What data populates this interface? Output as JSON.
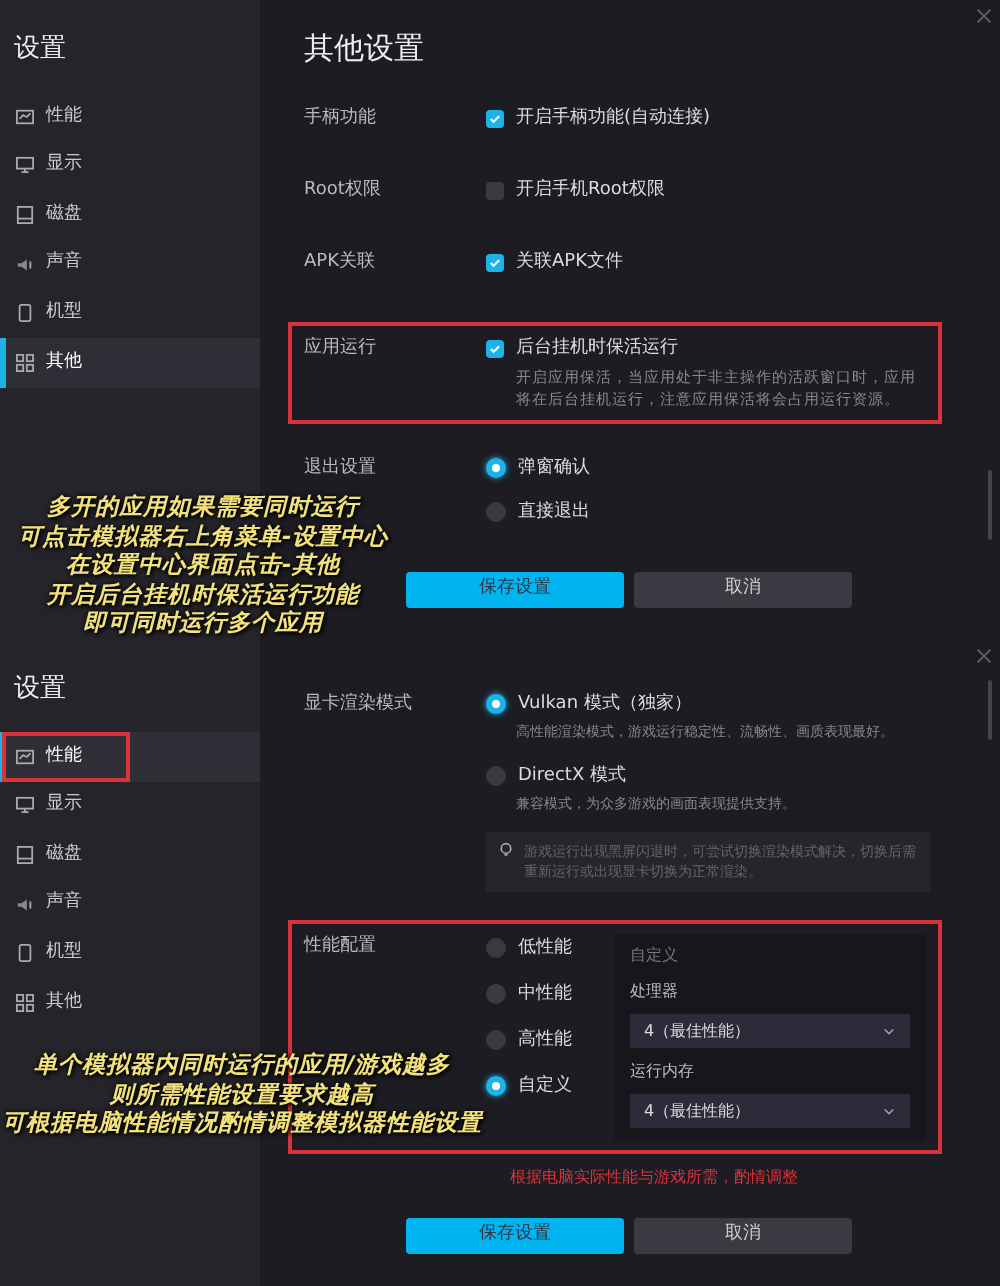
{
  "panels": [
    {
      "sidebar": {
        "title": "设置",
        "items": [
          {
            "label": "性能",
            "selected": false,
            "highlighted": false
          },
          {
            "label": "显示",
            "selected": false,
            "highlighted": false
          },
          {
            "label": "磁盘",
            "selected": false,
            "highlighted": false
          },
          {
            "label": "声音",
            "selected": false,
            "highlighted": false
          },
          {
            "label": "机型",
            "selected": false,
            "highlighted": false
          },
          {
            "label": "其他",
            "selected": true,
            "highlighted": false
          }
        ]
      },
      "content": {
        "title": "其他设置",
        "rows": [
          {
            "kind": "checkbox",
            "label": "手柄功能",
            "highlighted": false,
            "options": [
              {
                "text": "开启手柄功能(自动连接)",
                "checked": true
              }
            ]
          },
          {
            "kind": "checkbox",
            "label": "Root权限",
            "highlighted": false,
            "options": [
              {
                "text": "开启手机Root权限",
                "checked": false
              }
            ]
          },
          {
            "kind": "checkbox",
            "label": "APK关联",
            "highlighted": false,
            "options": [
              {
                "text": "关联APK文件",
                "checked": true
              }
            ]
          },
          {
            "kind": "checkbox",
            "label": "应用运行",
            "highlighted": true,
            "options": [
              {
                "text": "后台挂机时保活运行",
                "checked": true,
                "description": "开启应用保活，当应用处于非主操作的活跃窗口时，应用将在后台挂机运行，注意应用保活将会占用运行资源。"
              }
            ]
          },
          {
            "kind": "radio",
            "label": "退出设置",
            "highlighted": false,
            "options": [
              {
                "text": "弹窗确认",
                "selected": true
              },
              {
                "text": "直接退出",
                "selected": false
              }
            ]
          }
        ],
        "buttons": [
          {
            "label": "保存设置",
            "kind": "primary"
          },
          {
            "label": "取消",
            "kind": "secondary"
          }
        ]
      },
      "annotation": [
        "多开的应用如果需要同时运行",
        "可点击模拟器右上角菜单-设置中心",
        "在设置中心界面点击-其他",
        "开启后台挂机时保活运行功能",
        "即可同时运行多个应用"
      ]
    },
    {
      "sidebar": {
        "title": "设置",
        "items": [
          {
            "label": "性能",
            "selected": true,
            "highlighted": true
          },
          {
            "label": "显示",
            "selected": false,
            "highlighted": false
          },
          {
            "label": "磁盘",
            "selected": false,
            "highlighted": false
          },
          {
            "label": "声音",
            "selected": false,
            "highlighted": false
          },
          {
            "label": "机型",
            "selected": false,
            "highlighted": false
          },
          {
            "label": "其他",
            "selected": false,
            "highlighted": false
          }
        ]
      },
      "content": {
        "rows": [
          {
            "kind": "radio",
            "label": "显卡渲染模式",
            "highlighted": false,
            "options": [
              {
                "text": "Vulkan 模式（独家）",
                "selected": true,
                "description": "高性能渲染模式，游戏运行稳定性、流畅性、画质表现最好。"
              },
              {
                "text": "DirectX 模式",
                "selected": false,
                "description": "兼容模式，为众多游戏的画面表现提供支持。"
              }
            ]
          },
          {
            "kind": "tip",
            "text": "游戏运行出现黑屏闪退时，可尝试切换渲染模式解决，切换后需重新运行或出现显卡切换为正常渲染。"
          },
          {
            "kind": "performance",
            "label": "性能配置",
            "highlighted": true,
            "options": [
              {
                "text": "低性能",
                "selected": false
              },
              {
                "text": "中性能",
                "selected": false
              },
              {
                "text": "高性能",
                "selected": false
              },
              {
                "text": "自定义",
                "selected": true
              }
            ],
            "custom": {
              "title": "自定义",
              "fields": [
                {
                  "label": "处理器",
                  "value": "4（最佳性能）"
                },
                {
                  "label": "运行内存",
                  "value": "4（最佳性能）"
                }
              ]
            }
          }
        ],
        "note": "根据电脑实际性能与游戏所需，酌情调整",
        "buttons": [
          {
            "label": "保存设置",
            "kind": "primary"
          },
          {
            "label": "取消",
            "kind": "secondary"
          }
        ]
      },
      "annotation": [
        "单个模拟器内同时运行的应用/游戏越多",
        "则所需性能设置要求越高",
        "可根据电脑性能情况酌情调整模拟器性能设置"
      ]
    }
  ]
}
